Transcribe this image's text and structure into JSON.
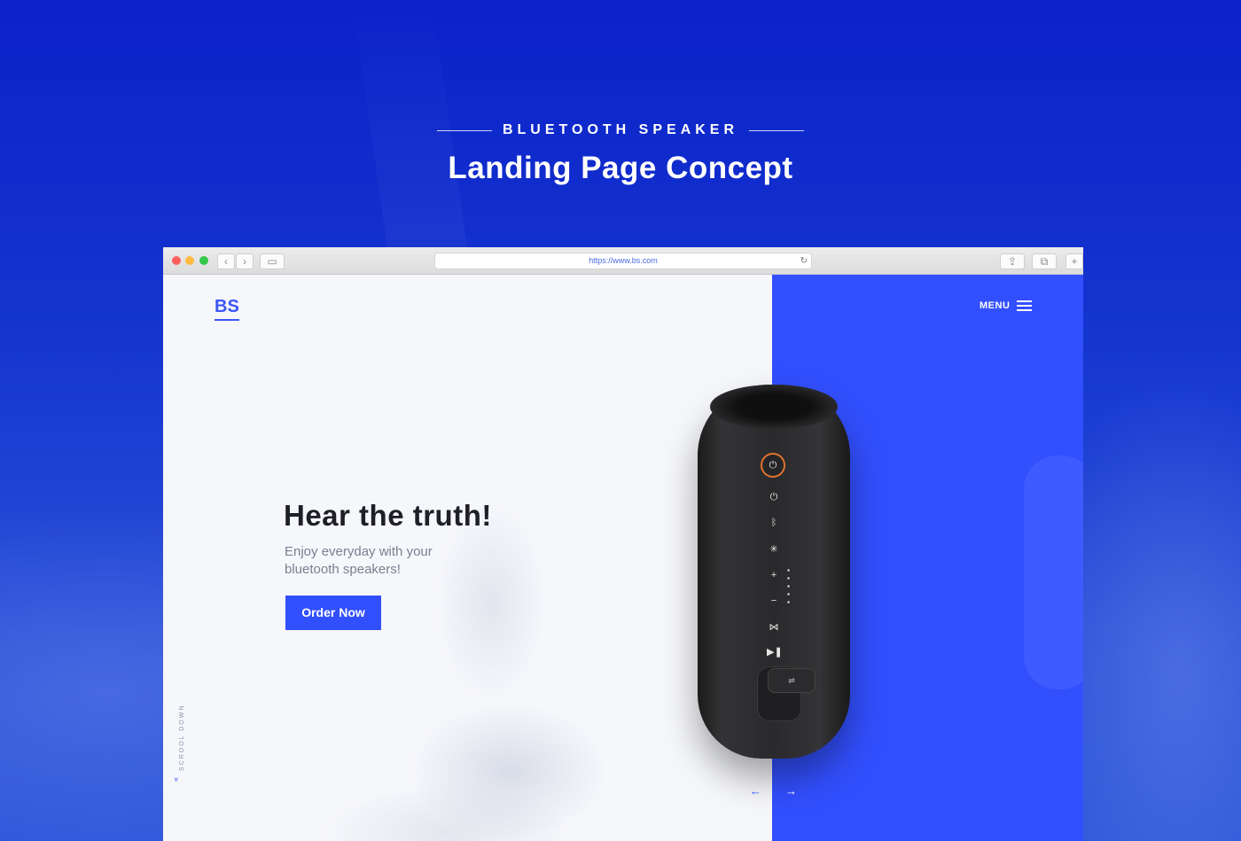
{
  "hero": {
    "eyebrow": "BLUETOOTH SPEAKER",
    "headline": "Landing Page Concept"
  },
  "browser": {
    "url": "https://www.bs.com",
    "reload_icon": "reload-icon",
    "toolbar_icons": [
      "back-icon",
      "forward-icon",
      "sidebar-icon",
      "share-icon",
      "tabs-icon",
      "new-tab-icon"
    ]
  },
  "site": {
    "logo": "BS",
    "menu_label": "MENU",
    "title": "Hear the truth!",
    "subtitle": "Enjoy everyday with your bluetooth speakers!",
    "cta_label": "Order Now",
    "scroll_label": "SCROOL DOWN"
  },
  "colors": {
    "accent": "#324ffe",
    "page_background": "#1535cf",
    "speaker_ring": "#e1722e"
  }
}
